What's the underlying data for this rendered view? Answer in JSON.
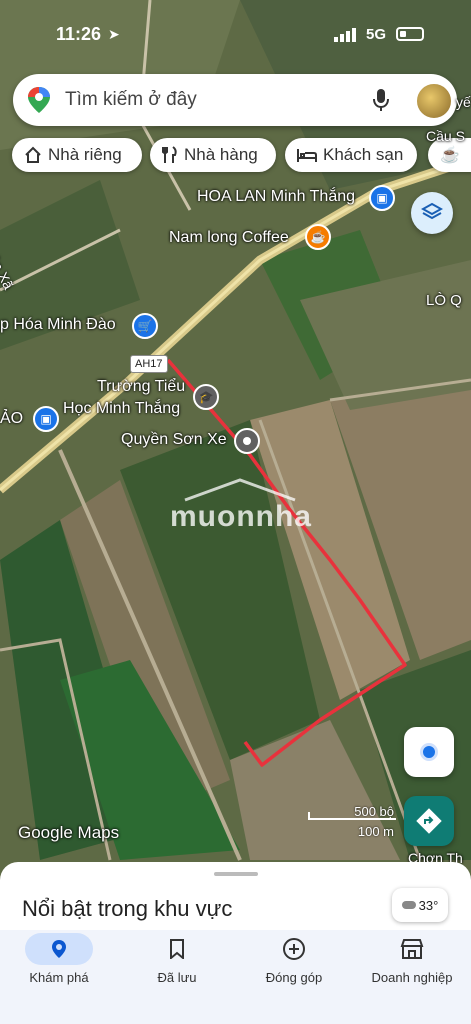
{
  "status": {
    "time": "11:26",
    "network": "5G"
  },
  "search": {
    "placeholder": "Tìm kiếm ở đây"
  },
  "chips": [
    {
      "label": "Nhà riêng",
      "icon": "home-icon"
    },
    {
      "label": "Nhà hàng",
      "icon": "restaurant-icon"
    },
    {
      "label": "Khách sạn",
      "icon": "hotel-icon"
    }
  ],
  "map": {
    "road_name": "Đường Liên Xã",
    "highway_badge": "AH17",
    "watermark": "muonnha",
    "attribution": "Google Maps",
    "edge_labels": [
      "Cầu S",
      "LÒ Q",
      "ẢO",
      "Chơn Th",
      "yế"
    ],
    "places": [
      {
        "name": "HOA LAN Minh Thắng",
        "icon": "shopping-bag-icon"
      },
      {
        "name": "Nam long Coffee",
        "icon": "coffee-icon"
      },
      {
        "name": "p Hóa Minh Đào",
        "icon": "cart-icon"
      },
      {
        "name_line1": "Trường Tiểu",
        "name_line2": "Học Minh Thắng",
        "icon": "school-icon"
      },
      {
        "name": "Quyền Sơn Xe",
        "icon": "place-dot-icon"
      }
    ],
    "scale": {
      "imperial": "500 bộ",
      "metric": "100 m"
    }
  },
  "sheet": {
    "title": "Nổi bật trong khu vực",
    "temperature": "33°"
  },
  "nav": [
    {
      "label": "Khám phá",
      "icon": "explore-pin-icon",
      "active": true
    },
    {
      "label": "Đã lưu",
      "icon": "bookmark-icon",
      "active": false
    },
    {
      "label": "Đóng góp",
      "icon": "add-circle-icon",
      "active": false
    },
    {
      "label": "Doanh nghiệp",
      "icon": "store-icon",
      "active": false
    }
  ],
  "colors": {
    "accent": "#1a73e8",
    "route": "#e8323c",
    "poi_blue": "#1a73e8",
    "poi_orange": "#f57c00",
    "poi_gray": "#616161",
    "directions_teal": "#0f7c74"
  }
}
